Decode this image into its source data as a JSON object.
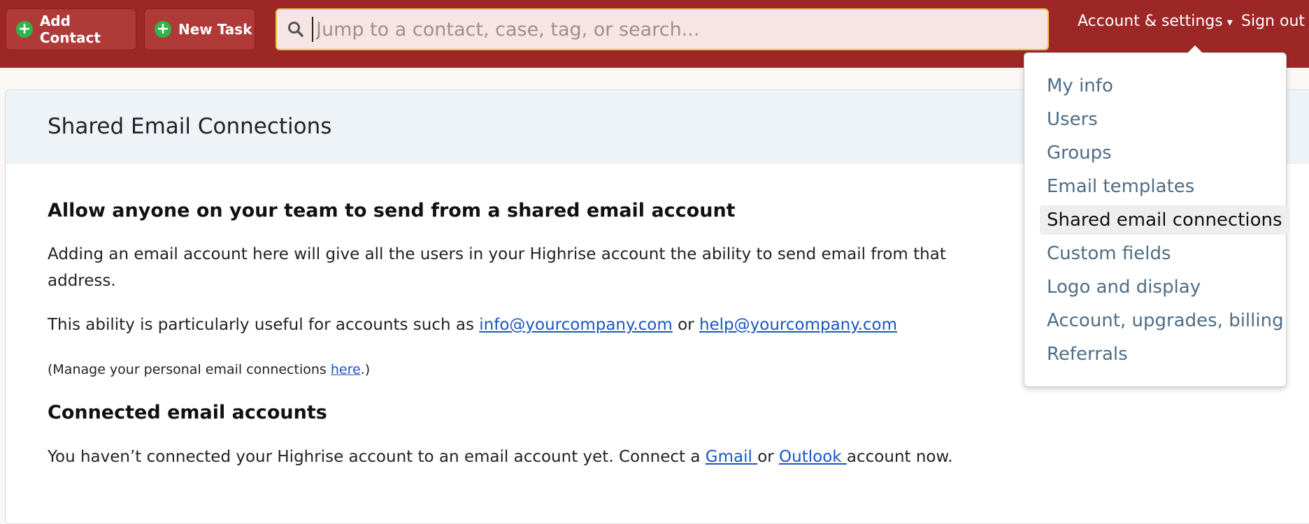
{
  "topbar": {
    "add_contact_label": "Add Contact",
    "new_task_label": "New Task",
    "search_placeholder": "Jump to a contact, case, tag, or search...",
    "account_settings_label": "Account & settings",
    "account_settings_arrow": "▾",
    "sign_out_label": "Sign out"
  },
  "panel": {
    "title": "Shared Email Connections",
    "section1_heading": "Allow anyone on your team to send from a shared email account",
    "intro_line1": "Adding an email account here will give all the users in your Highrise account the ability to send email from that",
    "intro_line2": "address.",
    "useful_prefix": "This ability is particularly useful for accounts such as ",
    "email_info": "info@yourcompany.com",
    "useful_or": " or ",
    "email_help": "help@yourcompany.com",
    "manage_prefix": "(Manage your personal email connections ",
    "manage_link": "here",
    "manage_suffix": ".)",
    "section2_heading": "Connected email accounts",
    "connect_prefix": "You haven’t connected your Highrise account to an email account yet. Connect a ",
    "gmail_link": "Gmail ",
    "connect_or": "or ",
    "outlook_link": "Outlook ",
    "connect_suffix": "account now."
  },
  "dropdown": {
    "items": [
      {
        "label": "My info"
      },
      {
        "label": "Users"
      },
      {
        "label": "Groups"
      },
      {
        "label": "Email templates"
      },
      {
        "label": "Shared email connections",
        "active": true
      },
      {
        "label": "Custom fields"
      },
      {
        "label": "Logo and display"
      },
      {
        "label": "Account, upgrades, billing"
      },
      {
        "label": "Referrals"
      }
    ]
  },
  "colors": {
    "topbar": "#9d2726",
    "plus_green": "#2fb34a",
    "link_blue": "#1a56c4",
    "menu_text": "#4e6d86"
  },
  "icons": {
    "add": "plus-circle-icon",
    "search": "search-icon",
    "dropdown": "caret-down-icon"
  }
}
